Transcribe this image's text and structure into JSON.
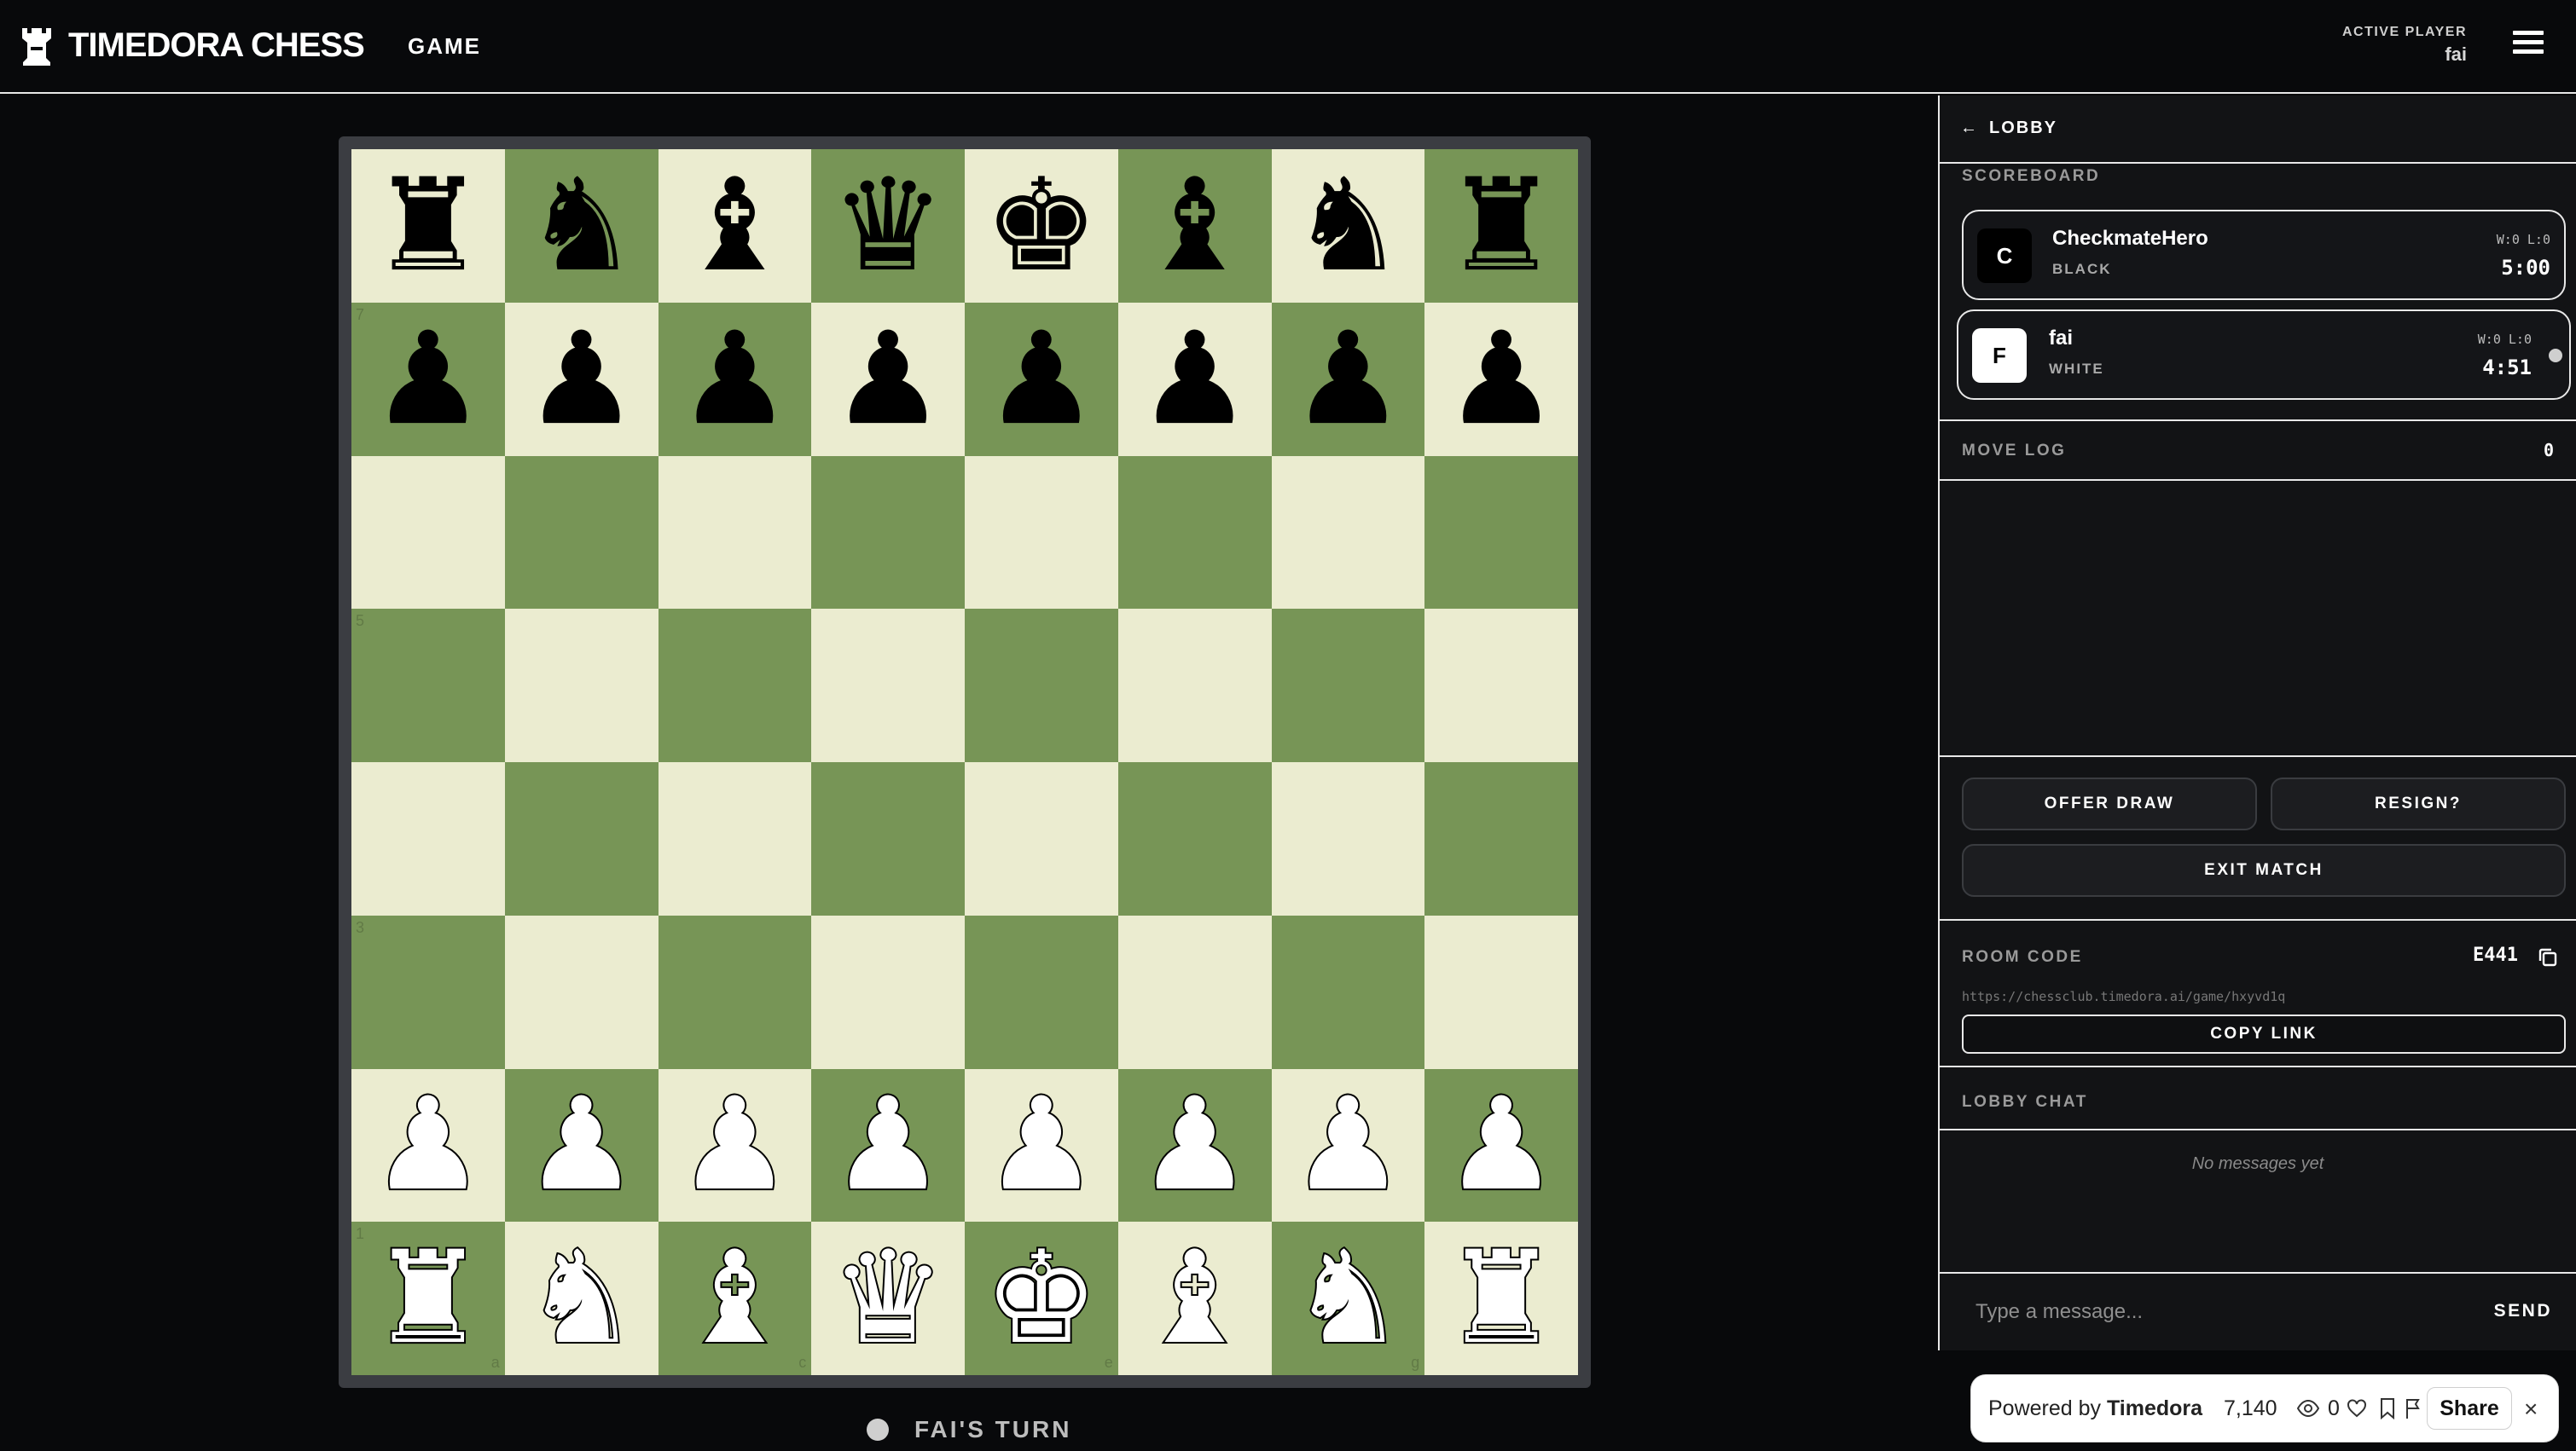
{
  "header": {
    "brand": "TIMEDORA CHESS",
    "nav_game": "GAME",
    "active_player_label": "ACTIVE PLAYER",
    "active_player_name": "fai"
  },
  "board": {
    "rows": [
      [
        "♜",
        "♞",
        "♝",
        "♛",
        "♚",
        "♝",
        "♞",
        "♜"
      ],
      [
        "♟",
        "♟",
        "♟",
        "♟",
        "♟",
        "♟",
        "♟",
        "♟"
      ],
      [
        "",
        "",
        "",
        "",
        "",
        "",
        "",
        ""
      ],
      [
        "",
        "",
        "",
        "",
        "",
        "",
        "",
        ""
      ],
      [
        "",
        "",
        "",
        "",
        "",
        "",
        "",
        ""
      ],
      [
        "",
        "",
        "",
        "",
        "",
        "",
        "",
        ""
      ],
      [
        "♟",
        "♟",
        "♟",
        "♟",
        "♟",
        "♟",
        "♟",
        "♟"
      ],
      [
        "♜",
        "♞",
        "♝",
        "♛",
        "♚",
        "♝",
        "♞",
        "♜"
      ]
    ],
    "rank_labels": [
      "7",
      "5",
      "3",
      "1"
    ],
    "file_labels": [
      "a",
      "c",
      "e",
      "g"
    ],
    "light_color": "#ebecd0",
    "dark_color": "#779556"
  },
  "turn_text": "FAI'S TURN",
  "sidebar": {
    "lobby_label": "LOBBY",
    "scoreboard_label": "SCOREBOARD",
    "players": [
      {
        "initial": "C",
        "name": "CheckmateHero",
        "color": "BLACK",
        "record": "W:0 L:0",
        "time": "5:00"
      },
      {
        "initial": "F",
        "name": "fai",
        "color": "WHITE",
        "record": "W:0 L:0",
        "time": "4:51"
      }
    ],
    "move_log_label": "MOVE LOG",
    "move_count": "0",
    "offer_draw": "OFFER DRAW",
    "resign": "RESIGN?",
    "exit_match": "EXIT MATCH",
    "room_code_label": "ROOM CODE",
    "room_code": "E441",
    "room_url": "https://chessclub.timedora.ai/game/hxyvd1q",
    "copy_link": "COPY LINK",
    "lobby_chat_label": "LOBBY CHAT",
    "no_messages": "No messages yet",
    "message_placeholder": "Type a message...",
    "send": "SEND"
  },
  "powered": {
    "prefix": "Powered by ",
    "brand": "Timedora",
    "views": "7,140",
    "likes": "0",
    "share": "Share",
    "close": "×"
  }
}
